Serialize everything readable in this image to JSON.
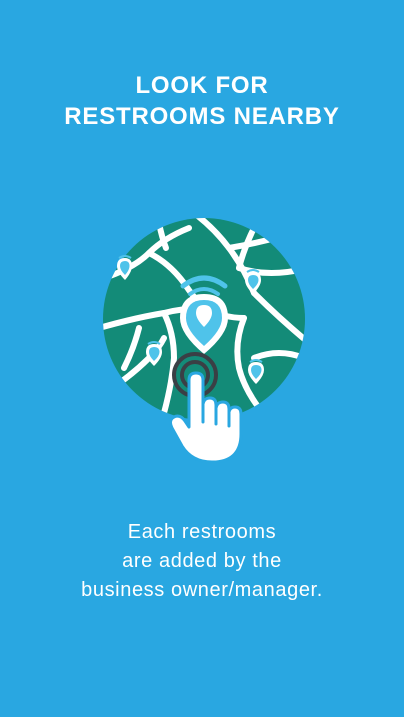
{
  "screen": {
    "background_color": "#29a7e1",
    "title_lines": [
      "LOOK FOR",
      "RESTROOMS NEARBY"
    ],
    "description_lines": [
      "Each restrooms",
      "are added by the",
      "business owner/manager."
    ]
  },
  "illustration": {
    "map_color": "#138b78",
    "road_color": "#ffffff",
    "pin_color": "#4fc3ea",
    "hand_color": "#ffffff",
    "icons": [
      "map-globe-icon",
      "location-pin-icon",
      "tap-hand-icon"
    ]
  }
}
